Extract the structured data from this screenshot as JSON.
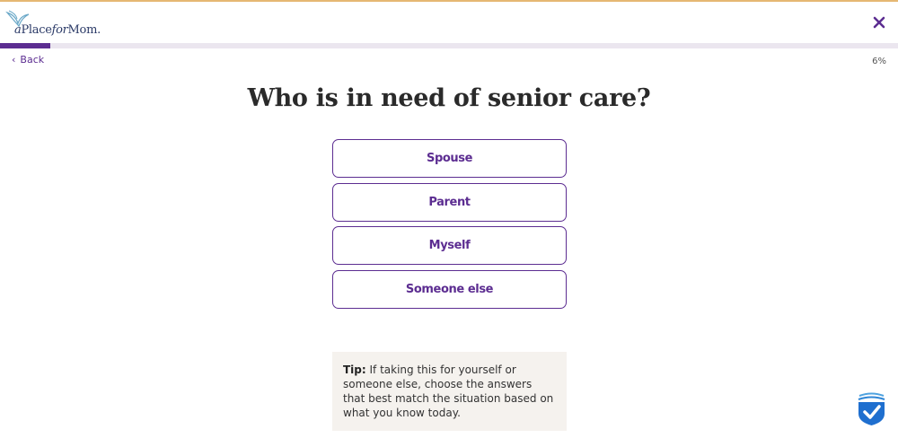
{
  "header": {
    "logo_text_a": "a",
    "logo_text_place": "Place",
    "logo_text_for": "for",
    "logo_text_mom": "Mom.",
    "close_icon": "close-x-icon"
  },
  "progress": {
    "fraction": 0.06,
    "label": "6%"
  },
  "nav": {
    "back_label": "Back",
    "back_icon": "chevron-left-icon"
  },
  "question": {
    "title": "Who is in need of senior care?",
    "options": [
      "Spouse",
      "Parent",
      "Myself",
      "Someone else"
    ]
  },
  "tip": {
    "label": "Tip:",
    "text": " If taking this for yourself or someone else, choose the answers that best match the situation based on what you know today."
  },
  "badge": {
    "icon": "verified-checkmark-shield-icon"
  },
  "colors": {
    "brand_purple": "#5c2d91",
    "tip_background": "#f5f2ee",
    "top_accent": "#e6b873"
  }
}
